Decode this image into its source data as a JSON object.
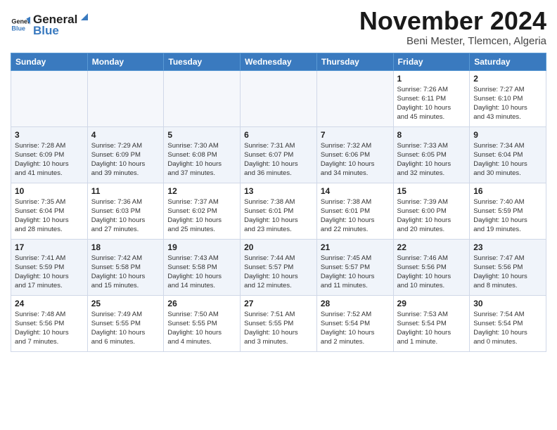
{
  "header": {
    "logo_line1": "General",
    "logo_line2": "Blue",
    "month": "November 2024",
    "location": "Beni Mester, Tlemcen, Algeria"
  },
  "weekdays": [
    "Sunday",
    "Monday",
    "Tuesday",
    "Wednesday",
    "Thursday",
    "Friday",
    "Saturday"
  ],
  "weeks": [
    [
      {
        "day": "",
        "info": ""
      },
      {
        "day": "",
        "info": ""
      },
      {
        "day": "",
        "info": ""
      },
      {
        "day": "",
        "info": ""
      },
      {
        "day": "",
        "info": ""
      },
      {
        "day": "1",
        "info": "Sunrise: 7:26 AM\nSunset: 6:11 PM\nDaylight: 10 hours\nand 45 minutes."
      },
      {
        "day": "2",
        "info": "Sunrise: 7:27 AM\nSunset: 6:10 PM\nDaylight: 10 hours\nand 43 minutes."
      }
    ],
    [
      {
        "day": "3",
        "info": "Sunrise: 7:28 AM\nSunset: 6:09 PM\nDaylight: 10 hours\nand 41 minutes."
      },
      {
        "day": "4",
        "info": "Sunrise: 7:29 AM\nSunset: 6:09 PM\nDaylight: 10 hours\nand 39 minutes."
      },
      {
        "day": "5",
        "info": "Sunrise: 7:30 AM\nSunset: 6:08 PM\nDaylight: 10 hours\nand 37 minutes."
      },
      {
        "day": "6",
        "info": "Sunrise: 7:31 AM\nSunset: 6:07 PM\nDaylight: 10 hours\nand 36 minutes."
      },
      {
        "day": "7",
        "info": "Sunrise: 7:32 AM\nSunset: 6:06 PM\nDaylight: 10 hours\nand 34 minutes."
      },
      {
        "day": "8",
        "info": "Sunrise: 7:33 AM\nSunset: 6:05 PM\nDaylight: 10 hours\nand 32 minutes."
      },
      {
        "day": "9",
        "info": "Sunrise: 7:34 AM\nSunset: 6:04 PM\nDaylight: 10 hours\nand 30 minutes."
      }
    ],
    [
      {
        "day": "10",
        "info": "Sunrise: 7:35 AM\nSunset: 6:04 PM\nDaylight: 10 hours\nand 28 minutes."
      },
      {
        "day": "11",
        "info": "Sunrise: 7:36 AM\nSunset: 6:03 PM\nDaylight: 10 hours\nand 27 minutes."
      },
      {
        "day": "12",
        "info": "Sunrise: 7:37 AM\nSunset: 6:02 PM\nDaylight: 10 hours\nand 25 minutes."
      },
      {
        "day": "13",
        "info": "Sunrise: 7:38 AM\nSunset: 6:01 PM\nDaylight: 10 hours\nand 23 minutes."
      },
      {
        "day": "14",
        "info": "Sunrise: 7:38 AM\nSunset: 6:01 PM\nDaylight: 10 hours\nand 22 minutes."
      },
      {
        "day": "15",
        "info": "Sunrise: 7:39 AM\nSunset: 6:00 PM\nDaylight: 10 hours\nand 20 minutes."
      },
      {
        "day": "16",
        "info": "Sunrise: 7:40 AM\nSunset: 5:59 PM\nDaylight: 10 hours\nand 19 minutes."
      }
    ],
    [
      {
        "day": "17",
        "info": "Sunrise: 7:41 AM\nSunset: 5:59 PM\nDaylight: 10 hours\nand 17 minutes."
      },
      {
        "day": "18",
        "info": "Sunrise: 7:42 AM\nSunset: 5:58 PM\nDaylight: 10 hours\nand 15 minutes."
      },
      {
        "day": "19",
        "info": "Sunrise: 7:43 AM\nSunset: 5:58 PM\nDaylight: 10 hours\nand 14 minutes."
      },
      {
        "day": "20",
        "info": "Sunrise: 7:44 AM\nSunset: 5:57 PM\nDaylight: 10 hours\nand 12 minutes."
      },
      {
        "day": "21",
        "info": "Sunrise: 7:45 AM\nSunset: 5:57 PM\nDaylight: 10 hours\nand 11 minutes."
      },
      {
        "day": "22",
        "info": "Sunrise: 7:46 AM\nSunset: 5:56 PM\nDaylight: 10 hours\nand 10 minutes."
      },
      {
        "day": "23",
        "info": "Sunrise: 7:47 AM\nSunset: 5:56 PM\nDaylight: 10 hours\nand 8 minutes."
      }
    ],
    [
      {
        "day": "24",
        "info": "Sunrise: 7:48 AM\nSunset: 5:56 PM\nDaylight: 10 hours\nand 7 minutes."
      },
      {
        "day": "25",
        "info": "Sunrise: 7:49 AM\nSunset: 5:55 PM\nDaylight: 10 hours\nand 6 minutes."
      },
      {
        "day": "26",
        "info": "Sunrise: 7:50 AM\nSunset: 5:55 PM\nDaylight: 10 hours\nand 4 minutes."
      },
      {
        "day": "27",
        "info": "Sunrise: 7:51 AM\nSunset: 5:55 PM\nDaylight: 10 hours\nand 3 minutes."
      },
      {
        "day": "28",
        "info": "Sunrise: 7:52 AM\nSunset: 5:54 PM\nDaylight: 10 hours\nand 2 minutes."
      },
      {
        "day": "29",
        "info": "Sunrise: 7:53 AM\nSunset: 5:54 PM\nDaylight: 10 hours\nand 1 minute."
      },
      {
        "day": "30",
        "info": "Sunrise: 7:54 AM\nSunset: 5:54 PM\nDaylight: 10 hours\nand 0 minutes."
      }
    ]
  ]
}
